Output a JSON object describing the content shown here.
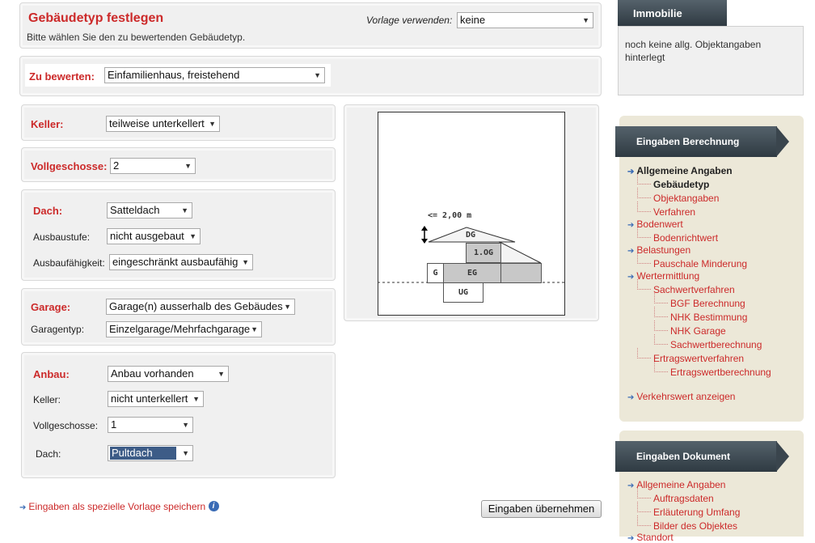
{
  "header": {
    "title": "Gebäudetyp festlegen",
    "subtitle": "Bitte wählen Sie den zu bewertenden Gebäudetyp.",
    "template_label": "Vorlage verwenden:",
    "template_value": "keine"
  },
  "zu_bewerten": {
    "label": "Zu bewerten:",
    "value": "Einfamilienhaus, freistehend"
  },
  "keller": {
    "label": "Keller:",
    "value": "teilweise unterkellert"
  },
  "vollgeschosse": {
    "label": "Vollgeschosse:",
    "value": "2"
  },
  "dach": {
    "label": "Dach:",
    "value": "Satteldach",
    "ausbaustufe_label": "Ausbaustufe:",
    "ausbaustufe_value": "nicht ausgebaut",
    "ausbaufaehigkeit_label": "Ausbaufähigkeit:",
    "ausbaufaehigkeit_value": "eingeschränkt ausbaufähig"
  },
  "garage": {
    "label": "Garage:",
    "value": "Garage(n) ausserhalb des Gebäudes",
    "typ_label": "Garagentyp:",
    "typ_value": "Einzelgarage/Mehrfachgarage"
  },
  "anbau": {
    "label": "Anbau:",
    "value": "Anbau vorhanden",
    "keller_label": "Keller:",
    "keller_value": "nicht unterkellert",
    "vollgeschosse_label": "Vollgeschosse:",
    "vollgeschosse_value": "1",
    "dach_label": "Dach:",
    "dach_value": "Pultdach"
  },
  "diagram": {
    "dimension": "<= 2,00 m",
    "dg": "DG",
    "og": "1.OG",
    "eg": "EG",
    "g": "G",
    "ug": "UG"
  },
  "footer": {
    "save_template": "Eingaben als spezielle Vorlage speichern",
    "apply_button": "Eingaben übernehmen"
  },
  "immobilie": {
    "tab": "Immobilie",
    "text": "noch keine allg. Objektangaben hinterlegt"
  },
  "berechnung": {
    "title": "Eingaben Berechnung",
    "items": [
      "Allgemeine Angaben",
      "Gebäudetyp",
      "Objektangaben",
      "Verfahren",
      "Bodenwert",
      "Bodenrichtwert",
      "Belastungen",
      "Pauschale Minderung",
      "Wertermittlung",
      "Sachwertverfahren",
      "BGF Berechnung",
      "NHK Bestimmung",
      "NHK Garage",
      "Sachwertberechnung",
      "Ertragswertverfahren",
      "Ertragswertberechnung",
      "Verkehrswert anzeigen"
    ]
  },
  "dokument": {
    "title": "Eingaben Dokument",
    "items": [
      "Allgemeine Angaben",
      "Auftragsdaten",
      "Erläuterung Umfang",
      "Bilder des Objektes",
      "Standort"
    ]
  }
}
